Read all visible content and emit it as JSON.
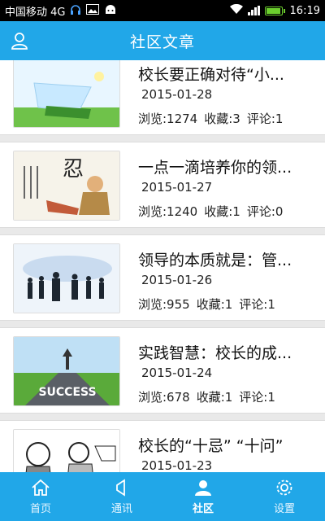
{
  "status_bar": {
    "carrier": "中国移动 4G",
    "time": "16:19"
  },
  "header": {
    "title": "社区文章",
    "user_icon": "user-icon"
  },
  "articles": [
    {
      "title": "校长要正确对待“小...",
      "date": "2015-01-28",
      "views": "浏览:1274",
      "favorites": "收藏:3",
      "comments": "评论:1",
      "image": "green-landscape-image"
    },
    {
      "title": "一点一滴培养你的领...",
      "date": "2015-01-27",
      "views": "浏览:1240",
      "favorites": "收藏:1",
      "comments": "评论:0",
      "image": "ink-painting-image"
    },
    {
      "title": "领导的本质就是：管...",
      "date": "2015-01-26",
      "views": "浏览:955",
      "favorites": "收藏:1",
      "comments": "评论:1",
      "image": "business-silhouettes-image"
    },
    {
      "title": "实践智慧：校长的成...",
      "date": "2015-01-24",
      "views": "浏览:678",
      "favorites": "收藏:1",
      "comments": "评论:1",
      "image": "success-road-image"
    },
    {
      "title": "校长的“十忌” “十问”",
      "date": "2015-01-23",
      "views": "",
      "favorites": "",
      "comments": "",
      "image": "cartoon-sketch-image"
    }
  ],
  "tabs": [
    {
      "label": "首页",
      "icon": "home-icon"
    },
    {
      "label": "通讯",
      "icon": "speaker-icon"
    },
    {
      "label": "社区",
      "icon": "community-user-icon",
      "active": true
    },
    {
      "label": "设置",
      "icon": "gear-icon"
    }
  ],
  "colors": {
    "accent": "#21a7e8",
    "status_bar": "#000000",
    "battery": "#6ccf2e"
  }
}
